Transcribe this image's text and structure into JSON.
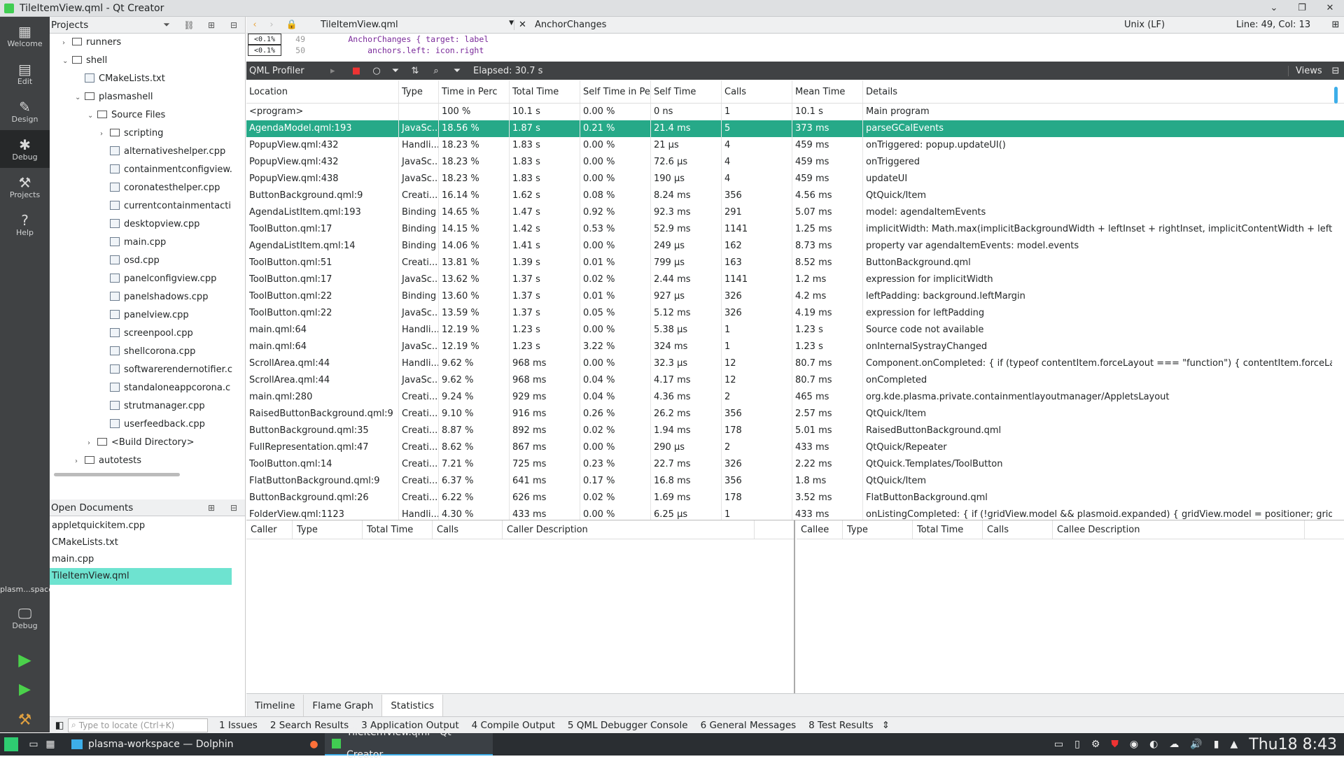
{
  "window": {
    "title": "TileItemView.qml - Qt Creator"
  },
  "modes": [
    {
      "label": "Welcome",
      "icon": "grid-icon"
    },
    {
      "label": "Edit",
      "icon": "document-icon"
    },
    {
      "label": "Design",
      "icon": "pen-icon"
    },
    {
      "label": "Debug",
      "icon": "bug-icon"
    },
    {
      "label": "Projects",
      "icon": "wrench-icon"
    },
    {
      "label": "Help",
      "icon": "help-icon"
    }
  ],
  "kit": {
    "name": "plasm...space",
    "mode": "Debug"
  },
  "projects": {
    "header": "Projects",
    "tree": [
      {
        "label": "runners",
        "level": 1,
        "kind": "folder",
        "exp": "›"
      },
      {
        "label": "shell",
        "level": 1,
        "kind": "folder",
        "exp": "⌄"
      },
      {
        "label": "CMakeLists.txt",
        "level": 2,
        "kind": "file",
        "exp": ""
      },
      {
        "label": "plasmashell",
        "level": 2,
        "kind": "target",
        "exp": "⌄"
      },
      {
        "label": "Source Files",
        "level": 3,
        "kind": "folder",
        "exp": "⌄"
      },
      {
        "label": "scripting",
        "level": 4,
        "kind": "folder",
        "exp": "›"
      },
      {
        "label": "alternativeshelper.cpp",
        "level": 4,
        "kind": "file",
        "exp": ""
      },
      {
        "label": "containmentconfigview.",
        "level": 4,
        "kind": "file",
        "exp": ""
      },
      {
        "label": "coronatesthelper.cpp",
        "level": 4,
        "kind": "file",
        "exp": ""
      },
      {
        "label": "currentcontainmentacti",
        "level": 4,
        "kind": "file",
        "exp": ""
      },
      {
        "label": "desktopview.cpp",
        "level": 4,
        "kind": "file",
        "exp": ""
      },
      {
        "label": "main.cpp",
        "level": 4,
        "kind": "file",
        "exp": ""
      },
      {
        "label": "osd.cpp",
        "level": 4,
        "kind": "file",
        "exp": ""
      },
      {
        "label": "panelconfigview.cpp",
        "level": 4,
        "kind": "file",
        "exp": ""
      },
      {
        "label": "panelshadows.cpp",
        "level": 4,
        "kind": "file",
        "exp": ""
      },
      {
        "label": "panelview.cpp",
        "level": 4,
        "kind": "file",
        "exp": ""
      },
      {
        "label": "screenpool.cpp",
        "level": 4,
        "kind": "file",
        "exp": ""
      },
      {
        "label": "shellcorona.cpp",
        "level": 4,
        "kind": "file",
        "exp": ""
      },
      {
        "label": "softwarerendernotifier.c",
        "level": 4,
        "kind": "file",
        "exp": ""
      },
      {
        "label": "standaloneappcorona.c",
        "level": 4,
        "kind": "file",
        "exp": ""
      },
      {
        "label": "strutmanager.cpp",
        "level": 4,
        "kind": "file",
        "exp": ""
      },
      {
        "label": "userfeedback.cpp",
        "level": 4,
        "kind": "file",
        "exp": ""
      },
      {
        "label": "<Build Directory>",
        "level": 3,
        "kind": "folder",
        "exp": "›"
      },
      {
        "label": "autotests",
        "level": 2,
        "kind": "folder",
        "exp": "›"
      }
    ]
  },
  "open_documents": {
    "header": "Open Documents",
    "items": [
      "appletquickitem.cpp",
      "CMakeLists.txt",
      "main.cpp",
      "TileItemView.qml"
    ],
    "selected": "TileItemView.qml"
  },
  "editor": {
    "file": "TileItemView.qml",
    "symbol": "AnchorChanges",
    "line_ending": "Unix (LF)",
    "position": "Line: 49, Col: 13",
    "code": [
      {
        "hint": "<0.1%",
        "ln": "49",
        "text": "        AnchorChanges { target: label"
      },
      {
        "hint": "<0.1%",
        "ln": "50",
        "text": "            anchors.left: icon.right"
      }
    ]
  },
  "profiler": {
    "name": "QML Profiler",
    "elapsed": "Elapsed:  30.7 s",
    "views": "Views"
  },
  "stats": {
    "columns": [
      "Location",
      "Type",
      "Time in Perc",
      "Total Time",
      "Self Time in Pe",
      "Self Time",
      "Calls",
      "Mean Time",
      "Details"
    ],
    "rows": [
      [
        "<program>",
        "",
        "100 %",
        "10.1 s",
        "0.00 %",
        "0 ns",
        "1",
        "10.1 s",
        "Main program"
      ],
      [
        "AgendaModel.qml:193",
        "JavaSc...",
        "18.56 %",
        "1.87 s",
        "0.21 %",
        "21.4 ms",
        "5",
        "373 ms",
        "parseGCalEvents"
      ],
      [
        "PopupView.qml:432",
        "Handli...",
        "18.23 %",
        "1.83 s",
        "0.00 %",
        "21 μs",
        "4",
        "459 ms",
        "onTriggered: popup.updateUI()"
      ],
      [
        "PopupView.qml:432",
        "JavaSc...",
        "18.23 %",
        "1.83 s",
        "0.00 %",
        "72.6 μs",
        "4",
        "459 ms",
        "onTriggered"
      ],
      [
        "PopupView.qml:438",
        "JavaSc...",
        "18.23 %",
        "1.83 s",
        "0.00 %",
        "190 μs",
        "4",
        "459 ms",
        "updateUI"
      ],
      [
        "ButtonBackground.qml:9",
        "Creati...",
        "16.14 %",
        "1.62 s",
        "0.08 %",
        "8.24 ms",
        "356",
        "4.56 ms",
        "QtQuick/Item"
      ],
      [
        "AgendaListItem.qml:193",
        "Binding",
        "14.65 %",
        "1.47 s",
        "0.92 %",
        "92.3 ms",
        "291",
        "5.07 ms",
        "model: agendaItemEvents"
      ],
      [
        "ToolButton.qml:17",
        "Binding",
        "14.15 %",
        "1.42 s",
        "0.53 %",
        "52.9 ms",
        "1141",
        "1.25 ms",
        "implicitWidth: Math.max(implicitBackgroundWidth + leftInset + rightInset, implicitContentWidth + leftPadd..."
      ],
      [
        "AgendaListItem.qml:14",
        "Binding",
        "14.06 %",
        "1.41 s",
        "0.00 %",
        "249 μs",
        "162",
        "8.73 ms",
        "property var agendaItemEvents: model.events"
      ],
      [
        "ToolButton.qml:51",
        "Creati...",
        "13.81 %",
        "1.39 s",
        "0.01 %",
        "799 μs",
        "163",
        "8.52 ms",
        "ButtonBackground.qml"
      ],
      [
        "ToolButton.qml:17",
        "JavaSc...",
        "13.62 %",
        "1.37 s",
        "0.02 %",
        "2.44 ms",
        "1141",
        "1.2 ms",
        "expression for implicitWidth"
      ],
      [
        "ToolButton.qml:22",
        "Binding",
        "13.60 %",
        "1.37 s",
        "0.01 %",
        "927 μs",
        "326",
        "4.2 ms",
        "leftPadding: background.leftMargin"
      ],
      [
        "ToolButton.qml:22",
        "JavaSc...",
        "13.59 %",
        "1.37 s",
        "0.05 %",
        "5.12 ms",
        "326",
        "4.19 ms",
        "expression for leftPadding"
      ],
      [
        "main.qml:64",
        "Handli...",
        "12.19 %",
        "1.23 s",
        "0.00 %",
        "5.38 μs",
        "1",
        "1.23 s",
        "Source code not available"
      ],
      [
        "main.qml:64",
        "JavaSc...",
        "12.19 %",
        "1.23 s",
        "3.22 %",
        "324 ms",
        "1",
        "1.23 s",
        "onInternalSystrayChanged"
      ],
      [
        "ScrollArea.qml:44",
        "Handli...",
        "9.62 %",
        "968 ms",
        "0.00 %",
        "32.3 μs",
        "12",
        "80.7 ms",
        "Component.onCompleted: { if (typeof contentItem.forceLayout === \"function\") { contentItem.forceLayout();..."
      ],
      [
        "ScrollArea.qml:44",
        "JavaSc...",
        "9.62 %",
        "968 ms",
        "0.04 %",
        "4.17 ms",
        "12",
        "80.7 ms",
        "onCompleted"
      ],
      [
        "main.qml:280",
        "Creati...",
        "9.24 %",
        "929 ms",
        "0.04 %",
        "4.36 ms",
        "2",
        "465 ms",
        "org.kde.plasma.private.containmentlayoutmanager/AppletsLayout"
      ],
      [
        "RaisedButtonBackground.qml:9",
        "Creati...",
        "9.10 %",
        "916 ms",
        "0.26 %",
        "26.2 ms",
        "356",
        "2.57 ms",
        "QtQuick/Item"
      ],
      [
        "ButtonBackground.qml:35",
        "Creati...",
        "8.87 %",
        "892 ms",
        "0.02 %",
        "1.94 ms",
        "178",
        "5.01 ms",
        "RaisedButtonBackground.qml"
      ],
      [
        "FullRepresentation.qml:47",
        "Creati...",
        "8.62 %",
        "867 ms",
        "0.00 %",
        "290 μs",
        "2",
        "433 ms",
        "QtQuick/Repeater"
      ],
      [
        "ToolButton.qml:14",
        "Creati...",
        "7.21 %",
        "725 ms",
        "0.23 %",
        "22.7 ms",
        "326",
        "2.22 ms",
        "QtQuick.Templates/ToolButton"
      ],
      [
        "FlatButtonBackground.qml:9",
        "Creati...",
        "6.37 %",
        "641 ms",
        "0.17 %",
        "16.8 ms",
        "356",
        "1.8 ms",
        "QtQuick/Item"
      ],
      [
        "ButtonBackground.qml:26",
        "Creati...",
        "6.22 %",
        "626 ms",
        "0.02 %",
        "1.69 ms",
        "178",
        "3.52 ms",
        "FlatButtonBackground.qml"
      ],
      [
        "FolderView.qml:1123",
        "Handli...",
        "4.30 %",
        "433 ms",
        "0.00 %",
        "6.25 μs",
        "1",
        "433 ms",
        "onListingCompleted: { if (!gridView.model && plasmoid.expanded) { gridView.model = positioner; gridView...."
      ]
    ],
    "selected_index": 1
  },
  "callers": {
    "columns": [
      "Caller",
      "Type",
      "Total Time",
      "Calls",
      "Caller Description"
    ]
  },
  "callees": {
    "columns": [
      "Callee",
      "Type",
      "Total Time",
      "Calls",
      "Callee Description"
    ]
  },
  "view_tabs": [
    "Timeline",
    "Flame Graph",
    "Statistics"
  ],
  "active_view": "Statistics",
  "output_bar": {
    "locator_placeholder": "Type to locate (Ctrl+K)",
    "panes": [
      "1  Issues",
      "2  Search Results",
      "3  Application Output",
      "4  Compile Output",
      "5  QML Debugger Console",
      "6  General Messages",
      "8  Test Results"
    ]
  },
  "taskbar": {
    "tasks": [
      "plasma-workspace — Dolphin",
      "TileItemView.qml - Qt Creator"
    ],
    "clock": "Thu18 8:43"
  },
  "colors": {
    "selected_row": "#26a988",
    "selected_doc": "#6ee3d0",
    "sidebar": "#404244"
  }
}
